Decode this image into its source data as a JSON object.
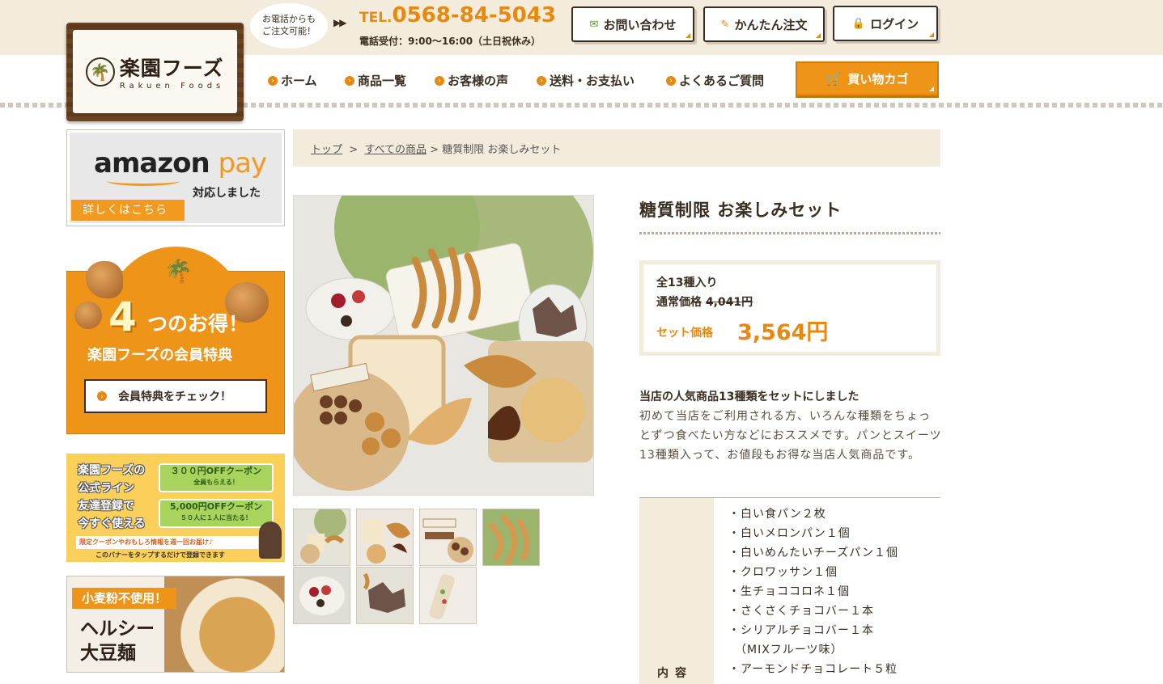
{
  "header": {
    "logo_jp": "楽園フーズ",
    "logo_en": "Rakuen Foods",
    "bubble_line1": "お電話からも",
    "bubble_line2": "ご注文可能！",
    "tel_prefix": "TEL.",
    "tel_number": "0568-84-5043",
    "hours": "電話受付：9:00〜16:00（土日祝休み）",
    "buttons": {
      "contact": "お問い合わせ",
      "order": "かんたん注文",
      "login": "ログイン"
    }
  },
  "nav": {
    "items": [
      "ホーム",
      "商品一覧",
      "お客様の声",
      "送料・お支払い",
      "よくあるご質問"
    ],
    "cart": "買い物カゴ"
  },
  "sidebar": {
    "amazon": {
      "logo_amazon": "amazon",
      "logo_pay": "pay",
      "sub": "対応しました",
      "tag": "詳しくはこちら"
    },
    "member": {
      "four": "4",
      "otoku": "つのお得！",
      "title": "楽園フーズの会員特典",
      "button": "会員特典をチェック！"
    },
    "line": {
      "left_lines": [
        "楽園フーズの",
        "公式ライン",
        "友達登録で",
        "今すぐ使える"
      ],
      "coupon1_main": "３００円OFFクーポン",
      "coupon1_sub": "全員もらえる！",
      "coupon2_main": "5,000円OFFクーポン",
      "coupon2_sub": "５０人に１人に当たる！",
      "bottom": "限定クーポンやおもしろ情報を週一回お届け♪",
      "tap": "このバナーをタップするだけで登録できます"
    },
    "noodle": {
      "tag": "小麦粉不使用！",
      "title1": "ヘルシー",
      "title2": "大豆麺"
    }
  },
  "breadcrumb": {
    "top": "トップ",
    "sep": ">",
    "all": "すべての商品",
    "current": "糖質制限 お楽しみセット"
  },
  "product": {
    "title": "糖質制限 お楽しみセット",
    "count": "全13種入り",
    "normal_label": "通常価格",
    "normal_price": "4,041円",
    "set_label": "セット価格",
    "set_price": "3,564円",
    "desc_heading": "当店の人気商品13種類をセットにしました",
    "desc_body": "初めて当店をご利用される方、いろんな種類をちょっとずつ食べたい方などにおススメです。パンとスイーツ13種類入って、お値段もお得な当店人気商品です。",
    "contents_label": "内容",
    "contents": [
      "・白い食パン２枚",
      "・白いメロンパン１個",
      "・白いめんたいチーズパン１個",
      "・クロワッサン１個",
      "・生チョココロネ１個",
      "・さくさくチョコバー１本",
      "・シリアルチョコバー１本",
      "　（MIXフルーツ味）",
      "・アーモンドチョコレート５粒"
    ]
  },
  "colors": {
    "accent": "#e8890f",
    "beige": "#f3ecdc",
    "brown": "#3a2e22"
  }
}
